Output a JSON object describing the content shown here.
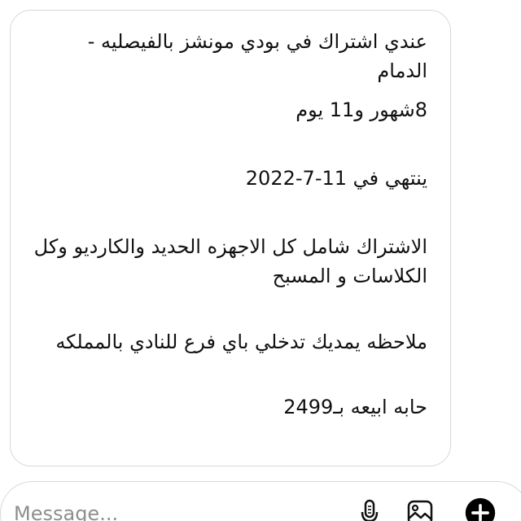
{
  "message": {
    "lines": [
      "عندي اشتراك في بودي مونشز بالفيصليه - الدمام",
      "8شهور و11 يوم",
      "ينتهي في 11-7-2022",
      "الاشتراك شامل كل الاجهزه الحديد والكارديو وكل الكلاسات و المسبح",
      "ملاحظه يمديك تدخلي باي فرع للنادي بالمملكه",
      "حابه ابيعه بـ2499"
    ]
  },
  "composer": {
    "placeholder": "Message...",
    "value": "",
    "icons": [
      "microphone-icon",
      "photo-icon",
      "plus-icon"
    ]
  },
  "colors": {
    "text": "#111111",
    "bubble_border": "#d9d9d9",
    "placeholder": "#8e8e8e",
    "plus_button": "#000000"
  }
}
